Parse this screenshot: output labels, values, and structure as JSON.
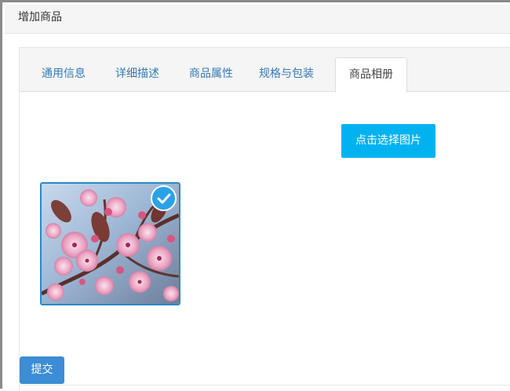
{
  "header": {
    "title": "增加商品"
  },
  "tabs": [
    {
      "label": "通用信息",
      "active": false
    },
    {
      "label": "详细描述",
      "active": false
    },
    {
      "label": "商品属性",
      "active": false
    },
    {
      "label": "规格与包装",
      "active": false
    },
    {
      "label": "商品相册",
      "active": true
    }
  ],
  "album": {
    "select_button_label": "点击选择图片",
    "images": [
      {
        "selected": true,
        "icon": "check-icon"
      }
    ]
  },
  "form": {
    "submit_label": "提交"
  },
  "colors": {
    "accent": "#00b3f0",
    "submit": "#3c8dd5",
    "tab_link": "#337ab7",
    "check_badge": "#2aa2e8"
  }
}
